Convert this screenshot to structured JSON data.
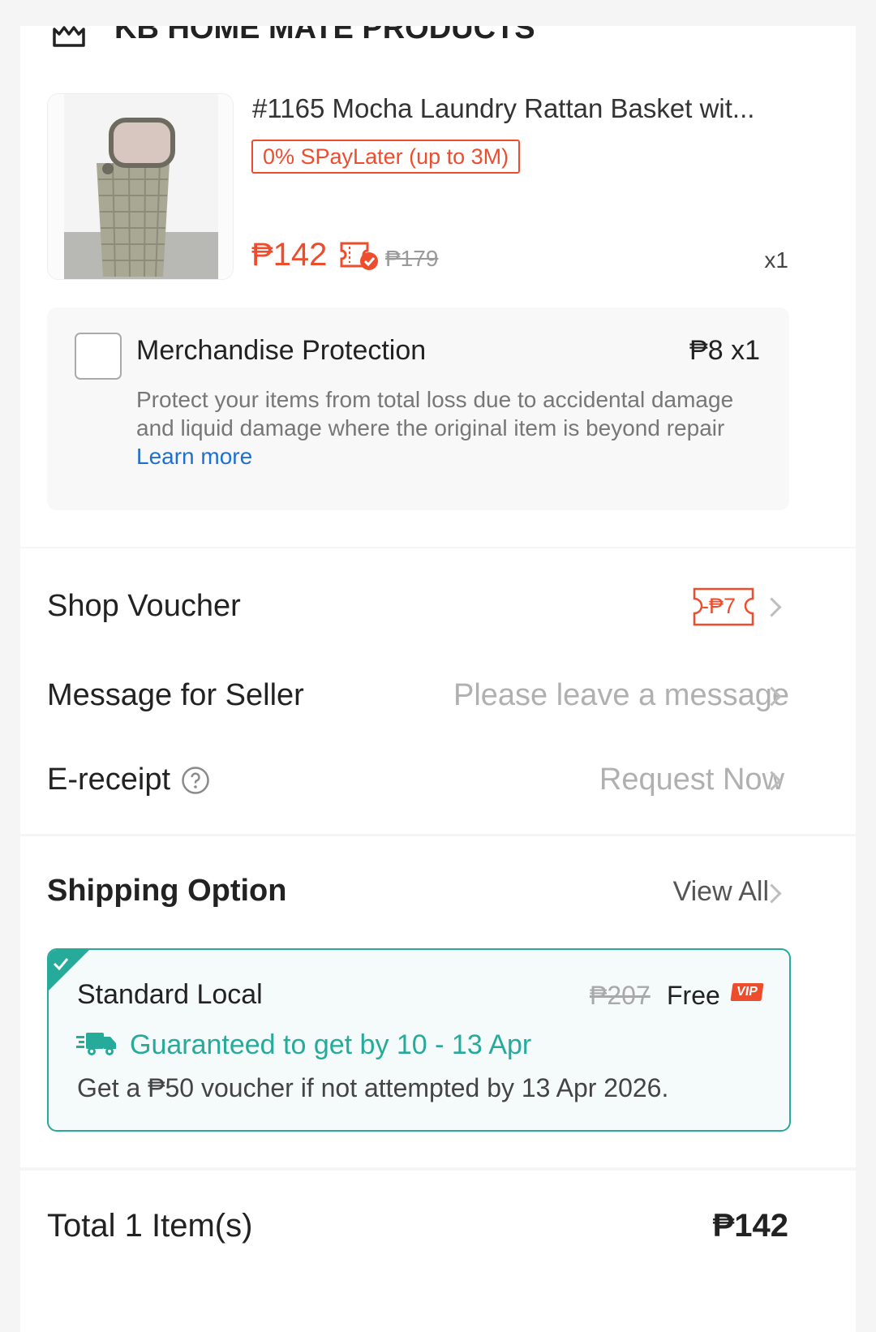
{
  "colors": {
    "accent": "#ee4d2d",
    "teal": "#26aa99",
    "link": "#1f6fd1",
    "muted": "#a9a9a9"
  },
  "shop": {
    "name": "KB HOME MATE PRODUCTS",
    "icon": "shop-icon"
  },
  "product": {
    "title": "#1165 Mocha Laundry Rattan Basket wit...",
    "image": "laundry-basket-image",
    "promo_tag": "0% SPayLater (up to 3M)",
    "price": "₱142",
    "price_badge_icon": "voucher-check-icon",
    "original_price": "₱179",
    "quantity": "x1"
  },
  "protection": {
    "title": "Merchandise Protection",
    "price_qty": "₱8 x1",
    "description": "Protect your items from total loss due to accidental damage and liquid damage where the original item is beyond repair",
    "learn_more": "Learn more",
    "checked": false
  },
  "shop_voucher": {
    "label": "Shop Voucher",
    "value": "-₱7"
  },
  "message": {
    "label": "Message for Seller",
    "placeholder": "Please leave a message"
  },
  "ereceipt": {
    "label": "E-receipt",
    "help_icon": "question-circle-icon",
    "action": "Request Now"
  },
  "shipping": {
    "title": "Shipping Option",
    "view_all": "View All",
    "option_name": "Standard Local",
    "original_fee": "₱207",
    "fee": "Free",
    "vip_badge": "VIP",
    "guarantee": "Guaranteed to get by 10 - 13 Apr",
    "truck_icon": "fast-truck-icon",
    "voucher_note": "Get a ₱50 voucher if not attempted by 13 Apr 2026."
  },
  "total": {
    "label": "Total 1 Item(s)",
    "amount": "₱142"
  }
}
